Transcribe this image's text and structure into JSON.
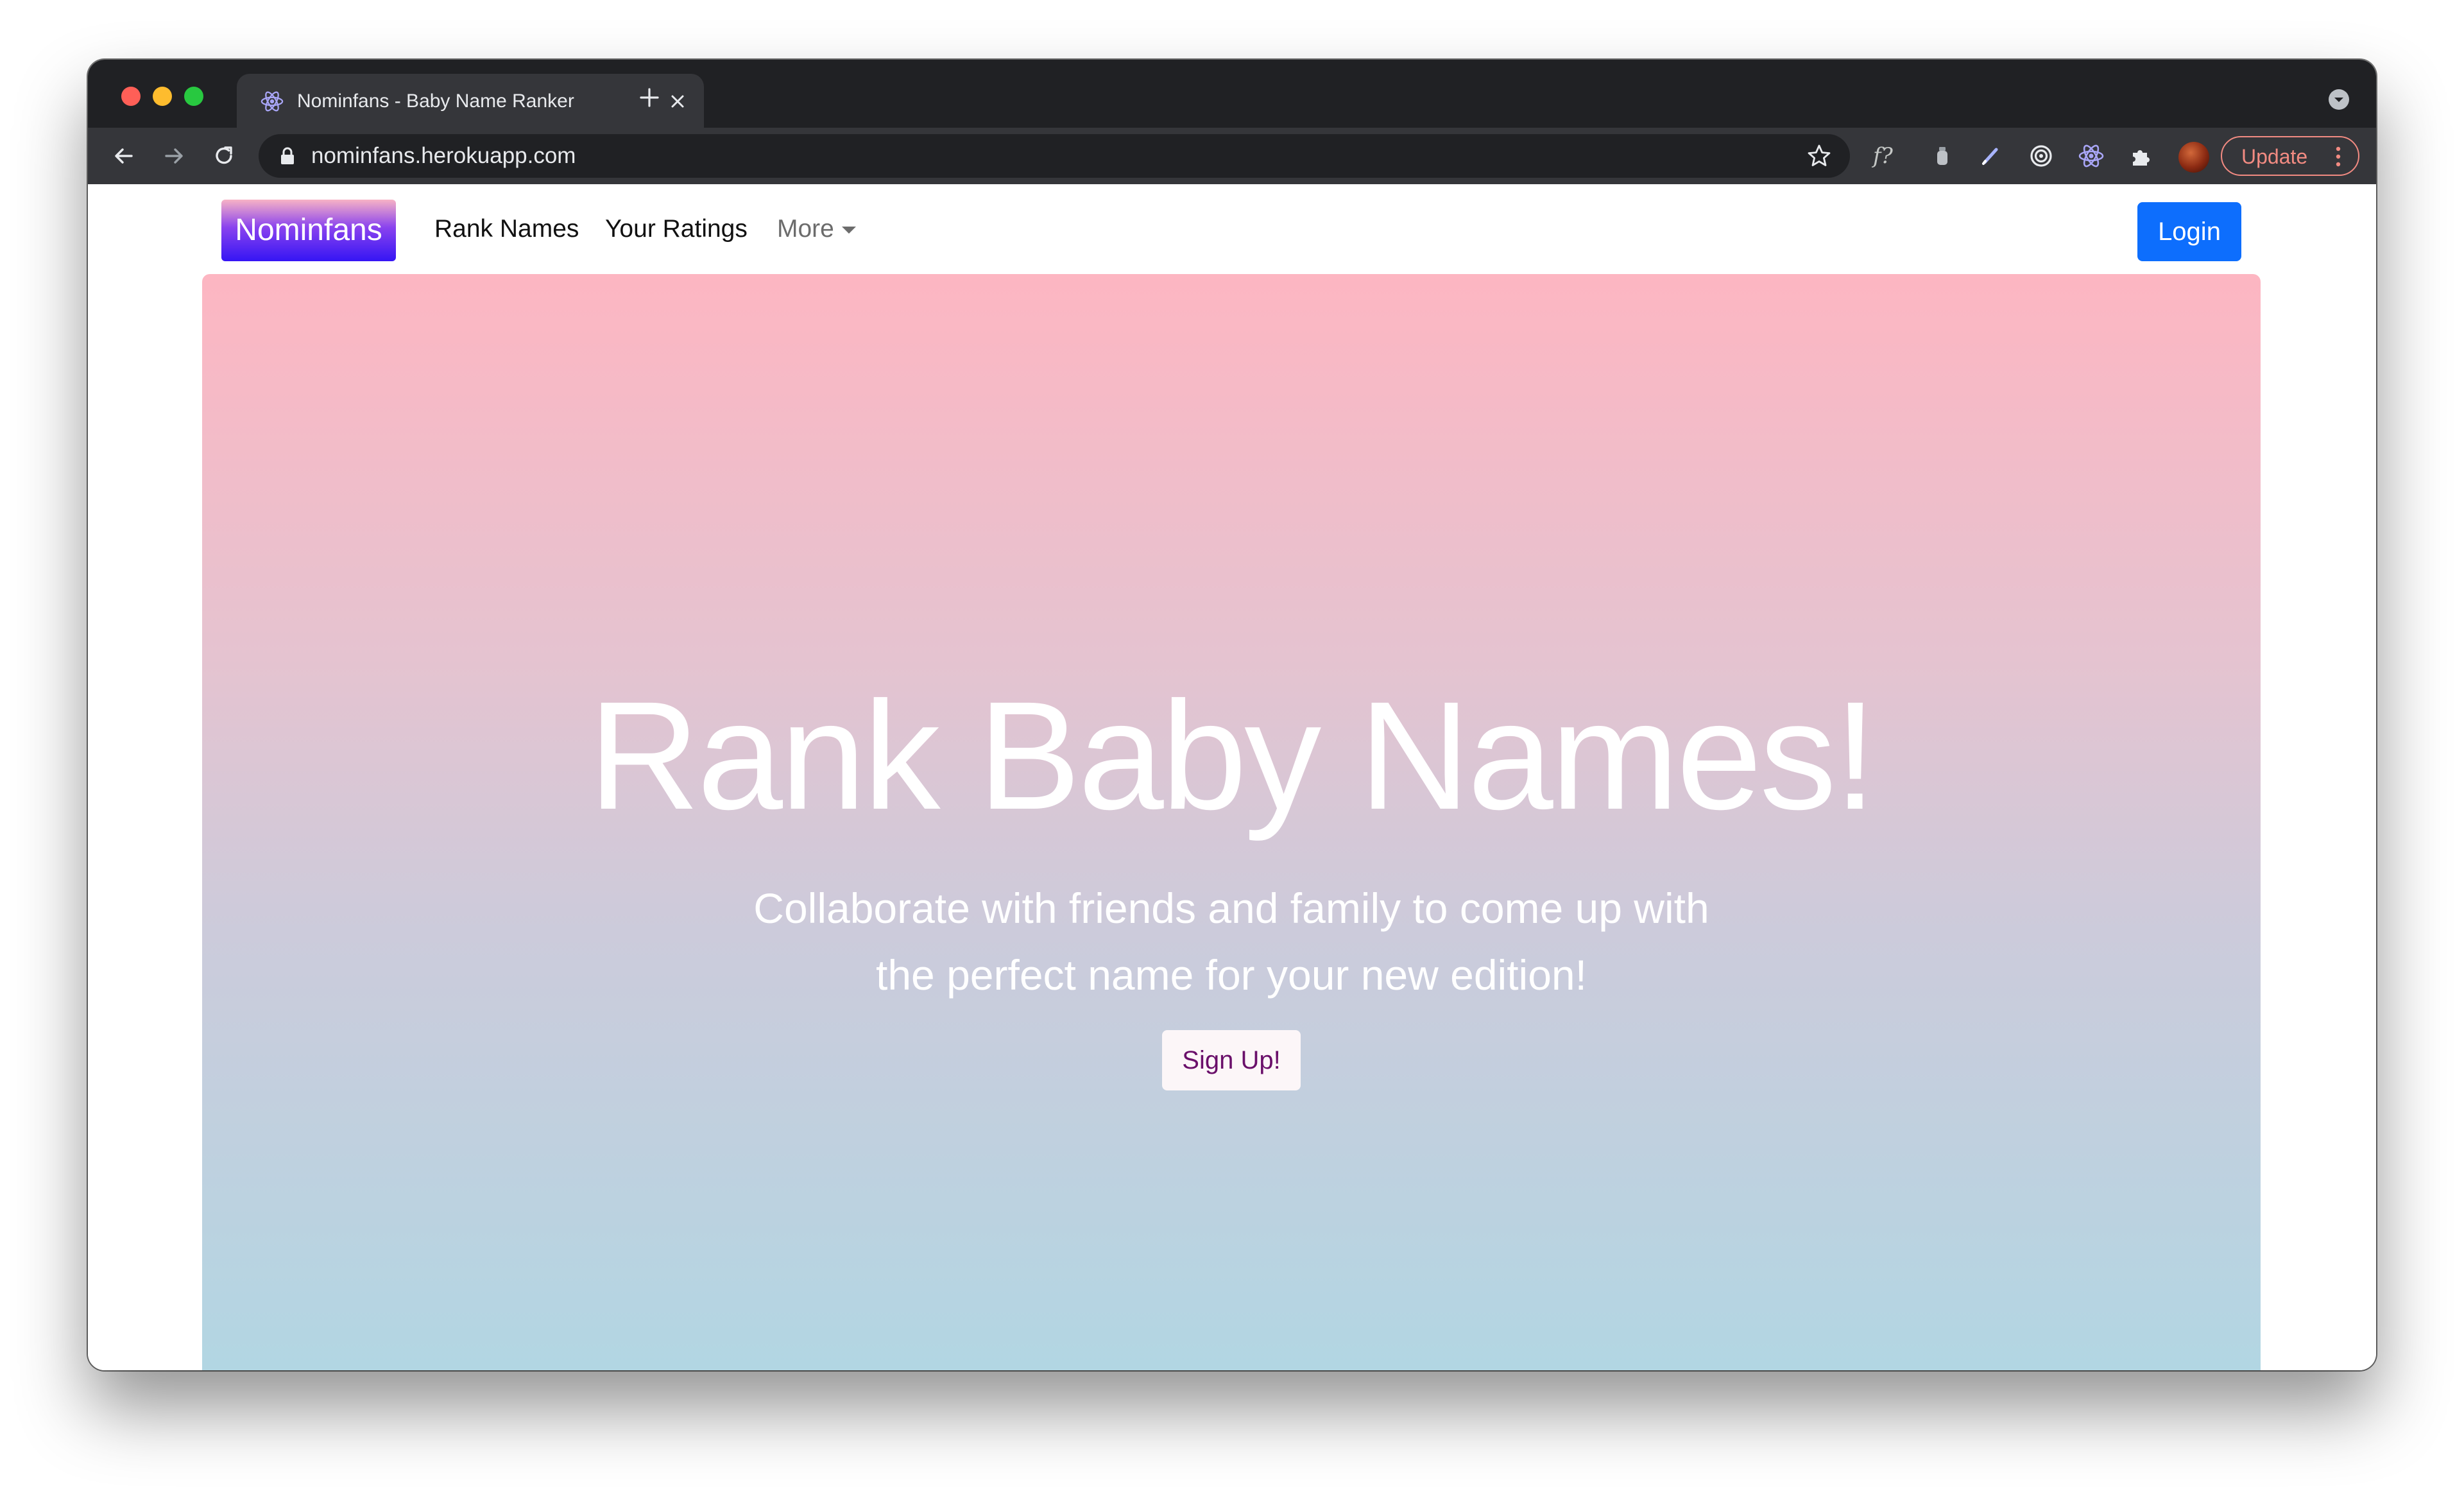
{
  "browser": {
    "tab": {
      "title": "Nominfans - Baby Name Ranker",
      "favicon": "react-icon"
    },
    "omnibox": {
      "url": "nominfans.herokuapp.com"
    },
    "extensions": [
      "f-question-extension-icon",
      "bottle-extension-icon",
      "pen-extension-icon",
      "target-extension-icon",
      "react-extension-icon",
      "puzzle-extension-icon"
    ],
    "extension_f_label": "f?",
    "update_label": "Update",
    "colors": {
      "frame": "#202124",
      "toolbar": "#35363a",
      "update_accent": "#f28b82"
    }
  },
  "navbar": {
    "brand": "Nominfans",
    "links": [
      "Rank Names",
      "Your Ratings"
    ],
    "more_label": "More",
    "login_label": "Login",
    "colors": {
      "login_bg": "#0d6efd"
    }
  },
  "hero": {
    "title": "Rank Baby Names!",
    "subtitle_line1": "Collaborate with friends and family to come up with",
    "subtitle_line2": "the perfect name for your new edition!",
    "signup_label": "Sign Up!",
    "colors": {
      "gradient_top": "#fdb6c2",
      "gradient_bottom": "#b2d6e3",
      "signup_text": "#6a0f6a"
    }
  }
}
